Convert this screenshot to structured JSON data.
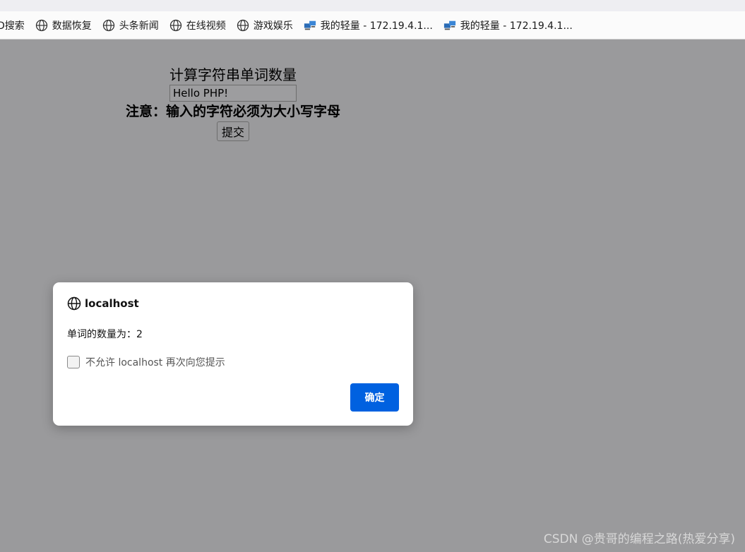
{
  "bookmarks": [
    {
      "label": "D搜索",
      "icon": "none"
    },
    {
      "label": "数据恢复",
      "icon": "globe-icon"
    },
    {
      "label": "头条新闻",
      "icon": "globe-icon"
    },
    {
      "label": "在线视频",
      "icon": "globe-icon"
    },
    {
      "label": "游戏娱乐",
      "icon": "globe-icon"
    },
    {
      "label": "我的轻量 - 172.19.4.1...",
      "icon": "network-icon"
    },
    {
      "label": "我的轻量 - 172.19.4.1...",
      "icon": "network-icon"
    }
  ],
  "form": {
    "title": "计算字符串单词数量",
    "input_value": "Hello PHP!",
    "note": "注意：输入的字符必须为大小写字母",
    "submit_label": "提交"
  },
  "dialog": {
    "host": "localhost",
    "message": "单词的数量为：2",
    "checkbox_label": "不允许 localhost 再次向您提示",
    "checkbox_checked": false,
    "ok_label": "确定"
  },
  "watermark": "CSDN @贵哥的编程之路(热爱分享)",
  "colors": {
    "overlay_bg": "#9a9a9c",
    "ok_button": "#0061e0"
  }
}
